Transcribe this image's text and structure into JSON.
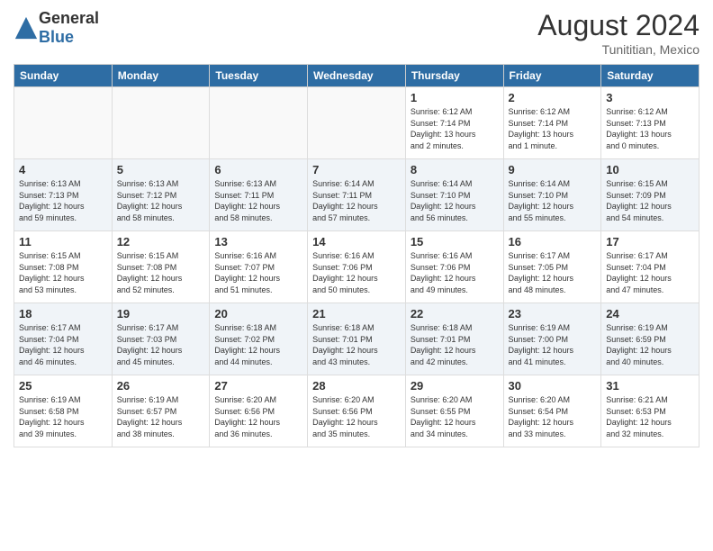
{
  "header": {
    "logo_general": "General",
    "logo_blue": "Blue",
    "month_title": "August 2024",
    "location": "Tunititian, Mexico"
  },
  "days_of_week": [
    "Sunday",
    "Monday",
    "Tuesday",
    "Wednesday",
    "Thursday",
    "Friday",
    "Saturday"
  ],
  "weeks": [
    [
      {
        "day": "",
        "info": ""
      },
      {
        "day": "",
        "info": ""
      },
      {
        "day": "",
        "info": ""
      },
      {
        "day": "",
        "info": ""
      },
      {
        "day": "1",
        "info": "Sunrise: 6:12 AM\nSunset: 7:14 PM\nDaylight: 13 hours\nand 2 minutes."
      },
      {
        "day": "2",
        "info": "Sunrise: 6:12 AM\nSunset: 7:14 PM\nDaylight: 13 hours\nand 1 minute."
      },
      {
        "day": "3",
        "info": "Sunrise: 6:12 AM\nSunset: 7:13 PM\nDaylight: 13 hours\nand 0 minutes."
      }
    ],
    [
      {
        "day": "4",
        "info": "Sunrise: 6:13 AM\nSunset: 7:13 PM\nDaylight: 12 hours\nand 59 minutes."
      },
      {
        "day": "5",
        "info": "Sunrise: 6:13 AM\nSunset: 7:12 PM\nDaylight: 12 hours\nand 58 minutes."
      },
      {
        "day": "6",
        "info": "Sunrise: 6:13 AM\nSunset: 7:11 PM\nDaylight: 12 hours\nand 58 minutes."
      },
      {
        "day": "7",
        "info": "Sunrise: 6:14 AM\nSunset: 7:11 PM\nDaylight: 12 hours\nand 57 minutes."
      },
      {
        "day": "8",
        "info": "Sunrise: 6:14 AM\nSunset: 7:10 PM\nDaylight: 12 hours\nand 56 minutes."
      },
      {
        "day": "9",
        "info": "Sunrise: 6:14 AM\nSunset: 7:10 PM\nDaylight: 12 hours\nand 55 minutes."
      },
      {
        "day": "10",
        "info": "Sunrise: 6:15 AM\nSunset: 7:09 PM\nDaylight: 12 hours\nand 54 minutes."
      }
    ],
    [
      {
        "day": "11",
        "info": "Sunrise: 6:15 AM\nSunset: 7:08 PM\nDaylight: 12 hours\nand 53 minutes."
      },
      {
        "day": "12",
        "info": "Sunrise: 6:15 AM\nSunset: 7:08 PM\nDaylight: 12 hours\nand 52 minutes."
      },
      {
        "day": "13",
        "info": "Sunrise: 6:16 AM\nSunset: 7:07 PM\nDaylight: 12 hours\nand 51 minutes."
      },
      {
        "day": "14",
        "info": "Sunrise: 6:16 AM\nSunset: 7:06 PM\nDaylight: 12 hours\nand 50 minutes."
      },
      {
        "day": "15",
        "info": "Sunrise: 6:16 AM\nSunset: 7:06 PM\nDaylight: 12 hours\nand 49 minutes."
      },
      {
        "day": "16",
        "info": "Sunrise: 6:17 AM\nSunset: 7:05 PM\nDaylight: 12 hours\nand 48 minutes."
      },
      {
        "day": "17",
        "info": "Sunrise: 6:17 AM\nSunset: 7:04 PM\nDaylight: 12 hours\nand 47 minutes."
      }
    ],
    [
      {
        "day": "18",
        "info": "Sunrise: 6:17 AM\nSunset: 7:04 PM\nDaylight: 12 hours\nand 46 minutes."
      },
      {
        "day": "19",
        "info": "Sunrise: 6:17 AM\nSunset: 7:03 PM\nDaylight: 12 hours\nand 45 minutes."
      },
      {
        "day": "20",
        "info": "Sunrise: 6:18 AM\nSunset: 7:02 PM\nDaylight: 12 hours\nand 44 minutes."
      },
      {
        "day": "21",
        "info": "Sunrise: 6:18 AM\nSunset: 7:01 PM\nDaylight: 12 hours\nand 43 minutes."
      },
      {
        "day": "22",
        "info": "Sunrise: 6:18 AM\nSunset: 7:01 PM\nDaylight: 12 hours\nand 42 minutes."
      },
      {
        "day": "23",
        "info": "Sunrise: 6:19 AM\nSunset: 7:00 PM\nDaylight: 12 hours\nand 41 minutes."
      },
      {
        "day": "24",
        "info": "Sunrise: 6:19 AM\nSunset: 6:59 PM\nDaylight: 12 hours\nand 40 minutes."
      }
    ],
    [
      {
        "day": "25",
        "info": "Sunrise: 6:19 AM\nSunset: 6:58 PM\nDaylight: 12 hours\nand 39 minutes."
      },
      {
        "day": "26",
        "info": "Sunrise: 6:19 AM\nSunset: 6:57 PM\nDaylight: 12 hours\nand 38 minutes."
      },
      {
        "day": "27",
        "info": "Sunrise: 6:20 AM\nSunset: 6:56 PM\nDaylight: 12 hours\nand 36 minutes."
      },
      {
        "day": "28",
        "info": "Sunrise: 6:20 AM\nSunset: 6:56 PM\nDaylight: 12 hours\nand 35 minutes."
      },
      {
        "day": "29",
        "info": "Sunrise: 6:20 AM\nSunset: 6:55 PM\nDaylight: 12 hours\nand 34 minutes."
      },
      {
        "day": "30",
        "info": "Sunrise: 6:20 AM\nSunset: 6:54 PM\nDaylight: 12 hours\nand 33 minutes."
      },
      {
        "day": "31",
        "info": "Sunrise: 6:21 AM\nSunset: 6:53 PM\nDaylight: 12 hours\nand 32 minutes."
      }
    ]
  ]
}
